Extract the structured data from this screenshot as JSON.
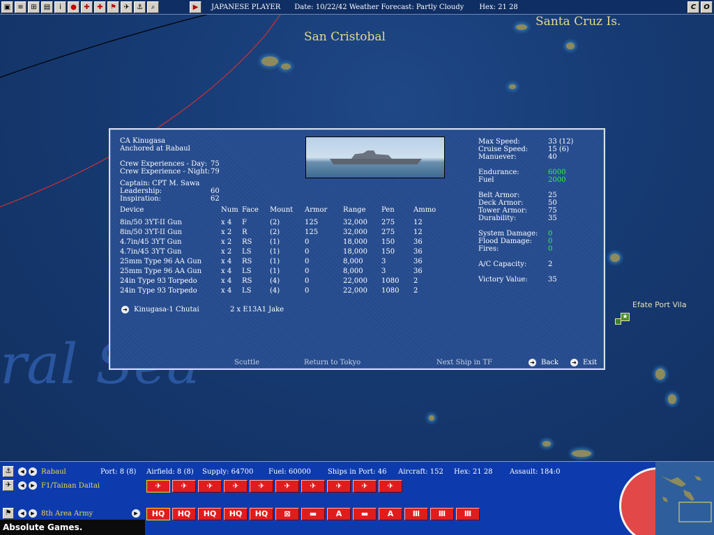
{
  "topbar": {
    "player": "JAPANESE PLAYER",
    "date": "Date:  10/22/42 Weather Forecast: Partly Cloudy",
    "hex": "Hex: 21 28",
    "buttons": [
      "▣",
      "≡",
      "⊞",
      "▤",
      "i",
      "●",
      "✚",
      "✚",
      "⚑",
      "✈",
      "⚓",
      "⌕"
    ],
    "right_buttons": [
      "C",
      "O"
    ]
  },
  "map": {
    "labels": {
      "san_cristobal": "San Cristobal",
      "santa_cruz": "Santa Cruz Is.",
      "efate": "Efate Port Vila",
      "coral_sea": "ral Sea",
      "sea_partial": "Sea"
    }
  },
  "ship": {
    "name": "CA Kinugasa",
    "status": "Anchored at Rabaul",
    "crew_day_label": "Crew Experiences - Day:",
    "crew_day": "75",
    "crew_night_label": "Crew Experience - Night:",
    "crew_night": "79",
    "captain": "Captain: CPT M. Sawa",
    "leadership_label": "Leadership:",
    "leadership": "60",
    "inspiration_label": "Inspiration:",
    "inspiration": "62",
    "stats": {
      "max_speed_label": "Max Speed:",
      "max_speed": "33  (12)",
      "cruise_speed_label": "Cruise Speed:",
      "cruise_speed": "15  (6)",
      "maneuver_label": "Manuever:",
      "maneuver": "40",
      "endurance_label": "Endurance:",
      "endurance": "6000",
      "fuel_label": "Fuel",
      "fuel": "2000",
      "belt_armor_label": "Belt Armor:",
      "belt_armor": "25",
      "deck_armor_label": "Deck Armor:",
      "deck_armor": "50",
      "tower_armor_label": "Tower Armor:",
      "tower_armor": "75",
      "durability_label": "Durability:",
      "durability": "35",
      "system_damage_label": "System Damage:",
      "system_damage": "0",
      "flood_damage_label": "Flood Damage:",
      "flood_damage": "0",
      "fires_label": "Fires:",
      "fires": "0",
      "ac_capacity_label": "A/C Capacity:",
      "ac_capacity": "2",
      "victory_value_label": "Victory Value:",
      "victory_value": "35"
    },
    "device_headers": [
      "Device",
      "Num",
      "Face",
      "Mount",
      "Armor",
      "Range",
      "Pen",
      "Ammo"
    ],
    "devices": [
      [
        "8in/50 3YT-II Gun",
        "x 4",
        "F",
        "(2)",
        "125",
        "32,000",
        "275",
        "12"
      ],
      [
        "8in/50 3YT-II Gun",
        "x 2",
        "R",
        "(2)",
        "125",
        "32,000",
        "275",
        "12"
      ],
      [
        "4.7in/45 3YT Gun",
        "x 2",
        "RS",
        "(1)",
        "0",
        "18,000",
        "150",
        "36"
      ],
      [
        "4.7in/45 3YT Gun",
        "x 2",
        "LS",
        "(1)",
        "0",
        "18,000",
        "150",
        "36"
      ],
      [
        "25mm Type 96 AA Gun",
        "x 4",
        "RS",
        "(1)",
        "0",
        "8,000",
        "3",
        "36"
      ],
      [
        "25mm Type 96 AA Gun",
        "x 4",
        "LS",
        "(1)",
        "0",
        "8,000",
        "3",
        "36"
      ],
      [
        "24in Type 93 Torpedo",
        "x 4",
        "RS",
        "(4)",
        "0",
        "22,000",
        "1080",
        "2"
      ],
      [
        "24in Type 93 Torpedo",
        "x 4",
        "LS",
        "(4)",
        "0",
        "22,000",
        "1080",
        "2"
      ]
    ],
    "air_group": "Kinugasa-1 Chutai",
    "air_group_aircraft": "2 x E13A1 Jake",
    "actions": {
      "scuttle": "Scuttle",
      "return": "Return to Tokyo",
      "next_ship": "Next Ship in TF",
      "back": "Back",
      "exit": "Exit"
    }
  },
  "bottom": {
    "base": "Rabaul",
    "port": "Port: 8 (8)",
    "airfield": "Airfield: 8 (8)",
    "supply": "Supply: 64700",
    "fuel": "Fuel: 60000",
    "ships": "Ships in Port: 46",
    "aircraft": "Aircraft: 152",
    "hex": "Hex: 21 28",
    "assault": "Assault: 184:0",
    "air_unit": "F1/Tainan Daitai",
    "army": "8th Area Army",
    "air_icons": [
      "✈",
      "✈",
      "✈",
      "✈",
      "✈",
      "✈",
      "✈",
      "✈",
      "✈",
      "✈"
    ],
    "ground_icons": [
      "HQ",
      "HQ",
      "HQ",
      "HQ",
      "HQ",
      "⊠",
      "▬",
      "A",
      "▬",
      "A",
      "Ⅲ",
      "Ⅲ",
      "Ⅲ"
    ]
  },
  "watermark": "Absolute Games. WWW.AG.RU"
}
